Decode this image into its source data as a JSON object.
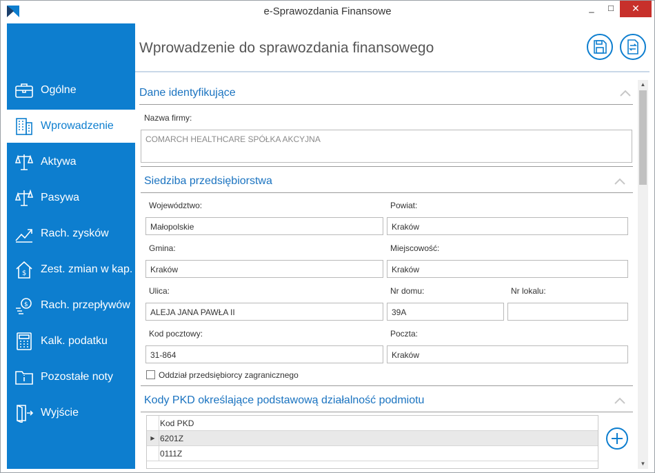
{
  "window": {
    "title": "e-Sprawozdania Finansowe",
    "controls": {
      "minimize": "_",
      "maximize": "□",
      "close": "✕"
    }
  },
  "sidebar": {
    "items": [
      {
        "label": "Ogólne",
        "icon": "briefcase-icon"
      },
      {
        "label": "Wprowadzenie",
        "icon": "building-icon",
        "active": true
      },
      {
        "label": "Aktywa",
        "icon": "scales-icon"
      },
      {
        "label": "Pasywa",
        "icon": "scales-icon"
      },
      {
        "label": "Rach. zysków",
        "icon": "chart-up-icon"
      },
      {
        "label": "Zest. zmian w kap.",
        "icon": "house-dollar-icon"
      },
      {
        "label": "Rach. przepływów",
        "icon": "money-flow-icon"
      },
      {
        "label": "Kalk. podatku",
        "icon": "calculator-icon"
      },
      {
        "label": "Pozostałe noty",
        "icon": "info-folder-icon"
      },
      {
        "label": "Wyjście",
        "icon": "exit-door-icon"
      }
    ]
  },
  "header": {
    "title": "Wprowadzenie do sprawozdania finansowego",
    "save_icon": "floppy-disk-icon",
    "export_icon": "document-exchange-icon"
  },
  "sections": {
    "identity": {
      "title": "Dane identyfikujące",
      "company_label": "Nazwa firmy:",
      "company_value": "COMARCH HEALTHCARE SPÓŁKA AKCYJNA"
    },
    "seat": {
      "title": "Siedziba przedsiębiorstwa",
      "voivodeship_label": "Województwo:",
      "voivodeship_value": "Małopolskie",
      "county_label": "Powiat:",
      "county_value": "Kraków",
      "commune_label": "Gmina:",
      "commune_value": "Kraków",
      "locality_label": "Miejscowość:",
      "locality_value": "Kraków",
      "street_label": "Ulica:",
      "street_value": "ALEJA JANA PAWŁA II",
      "house_label": "Nr domu:",
      "house_value": "39A",
      "apartment_label": "Nr lokalu:",
      "apartment_value": "",
      "postcode_label": "Kod pocztowy:",
      "postcode_value": "31-864",
      "post_label": "Poczta:",
      "post_value": "Kraków",
      "foreign_branch_label": "Oddział przedsiębiorcy zagranicznego",
      "foreign_branch_checked": false
    },
    "pkd": {
      "title": "Kody PKD określające podstawową działalność podmiotu",
      "column_header": "Kod PKD",
      "rows": [
        "6201Z",
        "0111Z"
      ],
      "selected_indicator": "▶"
    }
  },
  "colors": {
    "sidebar": "#0d7ecf",
    "accent_text": "#1a73c0",
    "close_button": "#c7302b"
  }
}
